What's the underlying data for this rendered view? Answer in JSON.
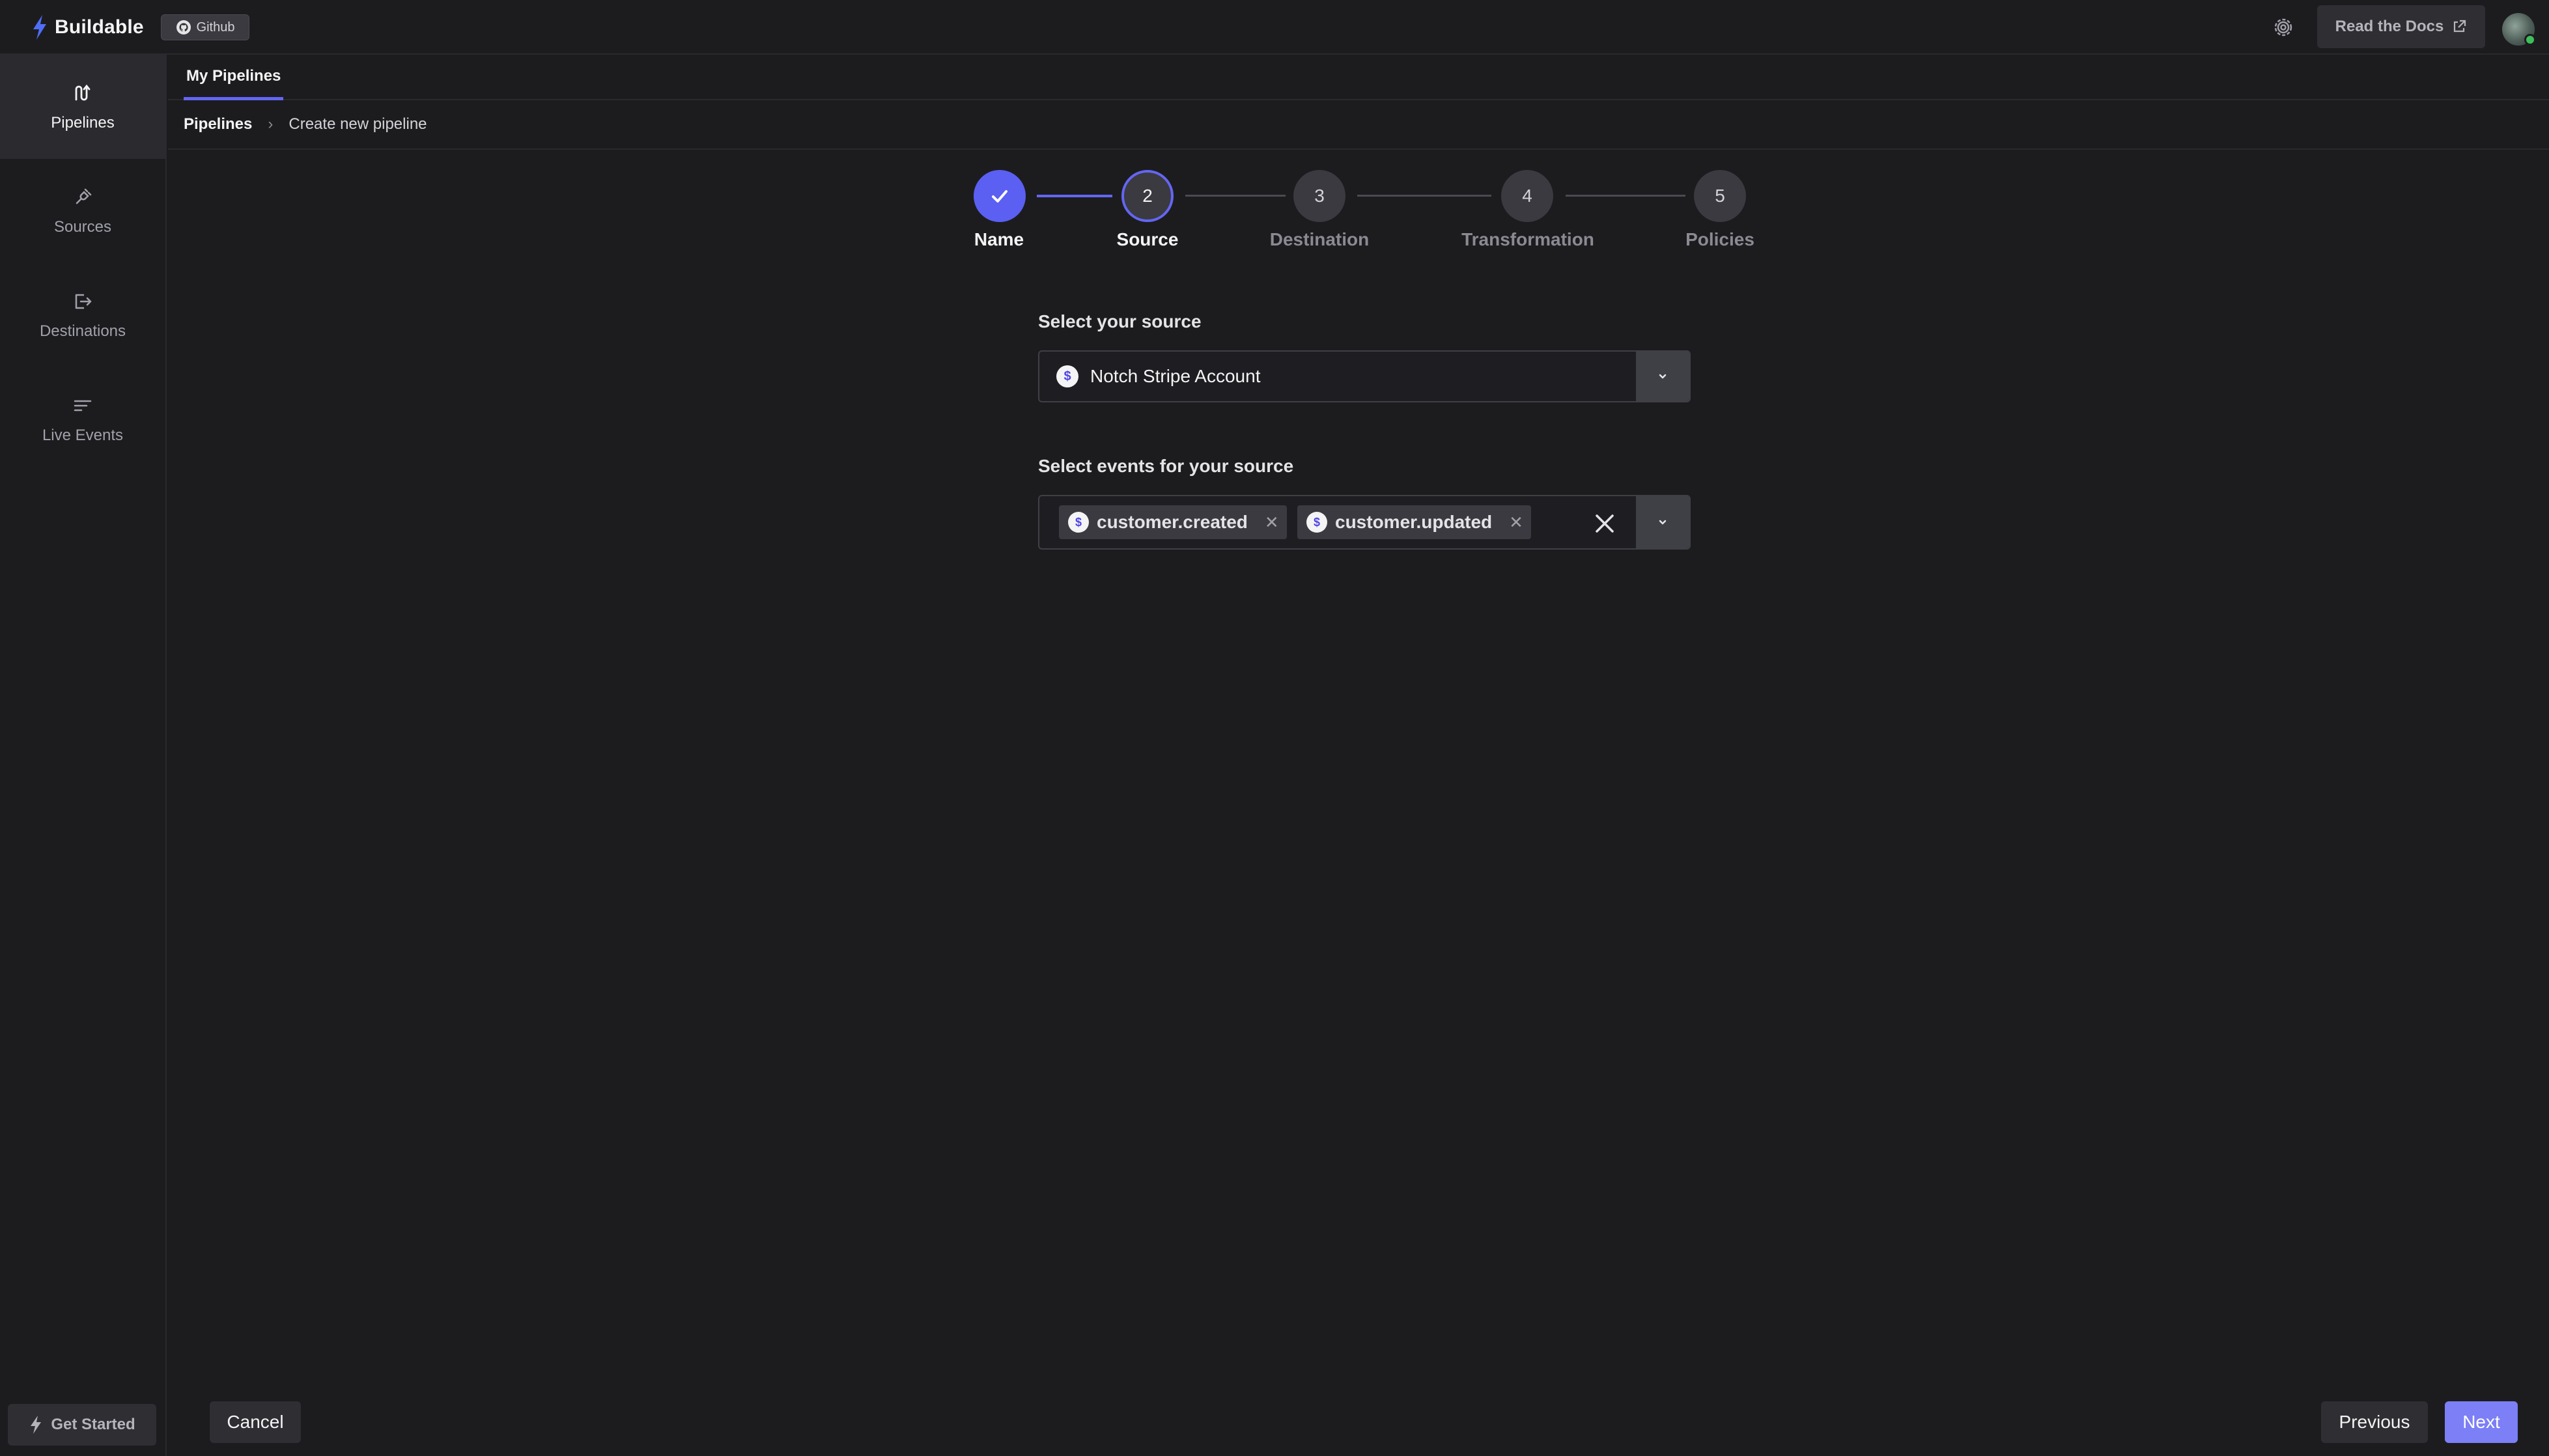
{
  "app": {
    "name": "Buildable",
    "github_label": "Github",
    "docs_label": "Read the Docs"
  },
  "sidebar": {
    "items": [
      {
        "label": "Pipelines",
        "icon": "pipelines-icon",
        "active": true
      },
      {
        "label": "Sources",
        "icon": "plug-icon",
        "active": false
      },
      {
        "label": "Destinations",
        "icon": "logout-icon",
        "active": false
      },
      {
        "label": "Live Events",
        "icon": "list-icon",
        "active": false
      }
    ],
    "get_started_label": "Get Started"
  },
  "tabs": [
    {
      "label": "My Pipelines",
      "active": true
    }
  ],
  "breadcrumb": {
    "root": "Pipelines",
    "separator": "›",
    "current": "Create new pipeline"
  },
  "stepper": {
    "steps": [
      {
        "number": "1",
        "label": "Name",
        "state": "done"
      },
      {
        "number": "2",
        "label": "Source",
        "state": "current"
      },
      {
        "number": "3",
        "label": "Destination",
        "state": "upcoming"
      },
      {
        "number": "4",
        "label": "Transformation",
        "state": "upcoming"
      },
      {
        "number": "5",
        "label": "Policies",
        "state": "upcoming"
      }
    ]
  },
  "form": {
    "source_label": "Select your source",
    "source_value": "Notch Stripe Account",
    "source_logo": "$",
    "events_label": "Select events for your source",
    "events": [
      "customer.created",
      "customer.updated"
    ],
    "event_logo": "$"
  },
  "footer": {
    "cancel_label": "Cancel",
    "previous_label": "Previous",
    "next_label": "Next"
  },
  "colors": {
    "accent": "#6366f1",
    "background": "#1c1c1f",
    "next_button": "#7c7ff5",
    "status_online": "#3fbf5a"
  }
}
